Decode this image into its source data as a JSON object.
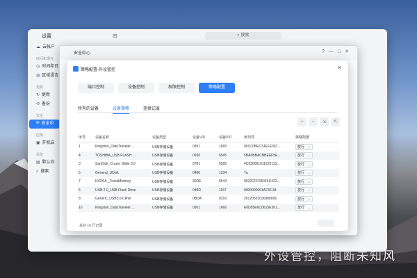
{
  "caption": "外设管控，阻断未知风",
  "settings_window": {
    "title": "设置",
    "search_placeholder": "搜索",
    "sidebar": [
      {
        "type": "item",
        "icon": "cloud-icon",
        "label": "云帐户"
      },
      {
        "type": "group",
        "label": "时间和语言"
      },
      {
        "type": "item",
        "icon": "clock-icon",
        "label": "时间和日"
      },
      {
        "type": "item",
        "icon": "globe-icon",
        "label": "区域语言"
      },
      {
        "type": "group",
        "label": "更新"
      },
      {
        "type": "item",
        "icon": "update-icon",
        "label": "更新"
      },
      {
        "type": "item",
        "icon": "backup-icon",
        "label": "备份"
      },
      {
        "type": "group",
        "label": "安全"
      },
      {
        "type": "item",
        "icon": "shield-icon",
        "label": "安全中",
        "active": true
      },
      {
        "type": "group",
        "label": "应用"
      },
      {
        "type": "item",
        "icon": "app-icon",
        "label": "开机启"
      },
      {
        "type": "group",
        "label": "系统"
      },
      {
        "type": "item",
        "icon": "default-app-icon",
        "label": "默认应"
      },
      {
        "type": "item",
        "icon": "search-icon",
        "label": "搜索"
      }
    ]
  },
  "security_window": {
    "title": "安全中心",
    "controls": [
      "?",
      "—",
      "□",
      "✕"
    ]
  },
  "dialog": {
    "title": "策略配置-外设管控",
    "top_tabs": [
      {
        "label": "端口控制",
        "active": false
      },
      {
        "label": "设备控制",
        "active": false
      },
      {
        "label": "权限控制",
        "active": false
      },
      {
        "label": "策略配置",
        "active": true
      }
    ],
    "sub_tabs": [
      {
        "label": "所有的设备",
        "active": false
      },
      {
        "label": "设备策略",
        "active": true
      },
      {
        "label": "连接记录",
        "active": false
      }
    ],
    "table": {
      "columns": [
        "序号",
        "设备名称",
        "设备类型",
        "设备VID",
        "设备PID",
        "序列号",
        "策略配置"
      ],
      "rows": [
        [
          "1",
          "Kingston_DataTraveler ...",
          "USB存储设备",
          "0951",
          "1665",
          "001C0BEC3JEFE007...",
          "放行"
        ],
        [
          "4",
          "TOSHIBA_USB FLASH ...",
          "USB存储设备",
          "0930",
          "6545",
          "5BA6BBACBBEEF5E...",
          "放行"
        ],
        [
          "3",
          "SanDisk_Cruzer Glide 3.0",
          "USB存储设备",
          "0781",
          "5595",
          "4C530001011222113...",
          "放行"
        ],
        [
          "5",
          "General_UDisk",
          "USB存储设备",
          "0480",
          "1234",
          "7a",
          "放行"
        ],
        [
          "7",
          "KIOXIA _TransMemory",
          "USB存储设备",
          "30DE",
          "6544",
          "0022CFF6B0F6C422...",
          "放行"
        ],
        [
          "6",
          "USB 2.0_USB Flash Drive",
          "USB存储设备",
          "048D",
          "1167",
          "0000000001AC5C44",
          "放行"
        ],
        [
          "8",
          "Generic_USB3.0-CRW",
          "USB存储设备",
          "0BDA",
          "0316",
          "20120501030900000",
          "放行"
        ],
        [
          "10",
          "Kingston_DataTraveler ...",
          "USB存储设备",
          "0951",
          "1666",
          "E0D55E6C0615E361...",
          "放行"
        ]
      ]
    },
    "total": "总共 10 行记录"
  }
}
